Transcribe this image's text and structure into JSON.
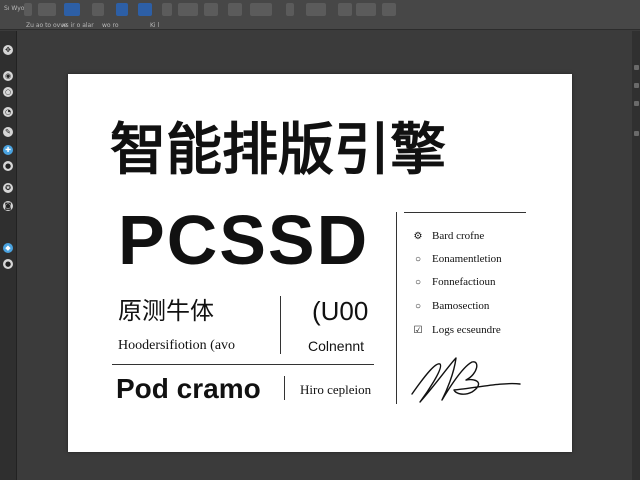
{
  "menubar": {
    "file_label": "Sı Wyo",
    "buttons": [
      "",
      "",
      "",
      "",
      "",
      "",
      "",
      "",
      "",
      "",
      "",
      "",
      "",
      "",
      "",
      "",
      "",
      ""
    ],
    "options": [
      "Zu ao to ovve",
      "xs ir o alar",
      "wo ro",
      "Ki l"
    ]
  },
  "tools": [
    {
      "icon": "move-icon",
      "glyph": "✥"
    },
    {
      "icon": "eye-icon",
      "glyph": "◉"
    },
    {
      "icon": "lasso-icon",
      "glyph": "○"
    },
    {
      "icon": "crop-icon",
      "glyph": "◔"
    },
    {
      "icon": "eyedropper-icon",
      "glyph": "✎"
    },
    {
      "icon": "healing-icon",
      "glyph": "✚"
    },
    {
      "icon": "brush-icon",
      "glyph": "●"
    },
    {
      "icon": "stamp-icon",
      "glyph": "✪"
    },
    {
      "icon": "eraser-icon",
      "glyph": "◙"
    },
    {
      "icon": "gradient-icon",
      "glyph": "◆"
    },
    {
      "icon": "dodge-icon",
      "glyph": "●"
    }
  ],
  "canvas": {
    "headline_cn": "智能排版引擎",
    "headline_en": "PCSSD",
    "sub_cn": "原测牛体",
    "sub_latin": "(U00",
    "desc_left": "Hoodersifiotion (avo",
    "desc_right": "Colnennt",
    "big_word": "Pod cramo",
    "small_word": "Hiro cepleion",
    "list": [
      {
        "icon": "gear-icon",
        "glyph": "⚙",
        "label": "Bard crofne"
      },
      {
        "icon": "circle-icon",
        "glyph": "○",
        "label": "Eonamentletion"
      },
      {
        "icon": "circle-icon",
        "glyph": "○",
        "label": "Fonnefactioun"
      },
      {
        "icon": "circle-icon",
        "glyph": "○",
        "label": "Bamosection"
      },
      {
        "icon": "edit-icon",
        "glyph": "☑",
        "label": "Logs ecseundre"
      }
    ]
  },
  "colors": {
    "app_bg": "#3b3b3b",
    "canvas_bg": "#ffffff",
    "accent": "#2d5fa6"
  }
}
